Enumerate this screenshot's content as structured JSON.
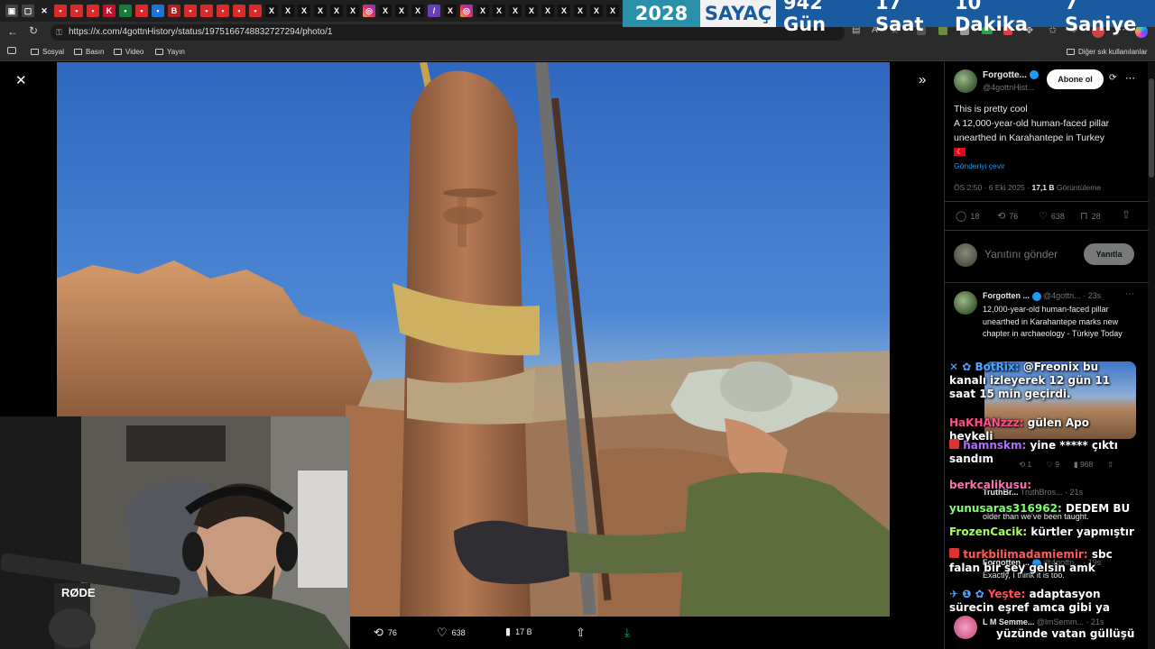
{
  "counter": {
    "year": "2028",
    "label": "SAYAÇ",
    "days": "942 Gün",
    "hours": "17 Saat",
    "minutes": "10 Dakika",
    "seconds": "7 Saniye"
  },
  "browser": {
    "url": "https://x.com/4gottnHistory/status/1975166748832727294/photo/1",
    "bookmarks": [
      "Sosyal",
      "Basın",
      "Video",
      "Yayın"
    ],
    "other_bookmarks": "Diğer sık kullanılanlar"
  },
  "photo_actions": {
    "reposts": "76",
    "likes": "638",
    "views": "17 B"
  },
  "tweet": {
    "author": "Forgotte...",
    "handle": "@4gottnHist...",
    "follow_label": "Abone ol",
    "text_line1": "This is pretty cool",
    "text_line2": "A 12,000-year-old human-faced pillar unearthed in Karahantepe in Turkey",
    "translate": "Gönderiyi çevir",
    "time": "ÖS 2:50 · 6 Eki 2025 ·",
    "views_count": "17,1 B",
    "views_label": "Görüntüleme",
    "replies": "18",
    "reposts": "76",
    "likes": "638",
    "bookmarks": "28"
  },
  "reply_box": {
    "placeholder": "Yanıtını gönder",
    "button": "Yanıtla"
  },
  "reply1": {
    "author": "Forgotten ...",
    "handle": "@4gottn...",
    "age": "· 23s",
    "text": "12,000-year-old human-faced pillar unearthed in Karahantepe marks new chapter in archaeology - Türkiye Today",
    "reposts": "1",
    "likes": "9",
    "views": "968"
  },
  "reply2": {
    "author": "TruthBr...",
    "handle": "TruthBros...",
    "age": "· 21s",
    "text": "older than we've been taught."
  },
  "reply3": {
    "author": "Forgotten ...",
    "handle": "@4gottn...",
    "age": "· 19s",
    "text": "Exactly, I think it is too."
  },
  "reply4": {
    "author": "L M Semme...",
    "handle": "@lmSemm...",
    "age": "· 21s"
  },
  "chat": [
    {
      "user": "BotRix:",
      "msg": "@Freonix bu kanalı izleyerek 12 gün 11 saat 15 min geçirdi.",
      "color": "#4fa3ff"
    },
    {
      "user": "HaKHANzzz:",
      "msg": "gülen Apo heykeli",
      "color": "#ff4f8b"
    },
    {
      "user": "hamnskm:",
      "msg": "yine ***** çıktı sandım",
      "color": "#b56cff"
    },
    {
      "user": "berkcalikusu:",
      "msg": "",
      "color": "#ff6fb0"
    },
    {
      "user": "yunusaras316962:",
      "msg": "DEDEM BU",
      "color": "#7dff6b"
    },
    {
      "user": "FrozenCacik:",
      "msg": "kürtler yapmıştır",
      "color": "#a6ff57"
    },
    {
      "user": "turkbilimadamiemir:",
      "msg": "sbc falan bir şey gelsin amk",
      "color": "#ff5a5a"
    },
    {
      "user": "Yeşte:",
      "msg": "adaptasyon sürecin eşref amca gibi ya",
      "color": "#ff4f4f"
    },
    {
      "user": "",
      "msg": "yüzünde vatan güllüşü",
      "color": "#ffffff"
    }
  ],
  "webcam": {
    "mic_brand": "RØDE"
  },
  "colors": {
    "counter_blue": "#1a5a9e",
    "counter_teal": "#2a8fa8",
    "x_blue": "#1d9bf0"
  }
}
